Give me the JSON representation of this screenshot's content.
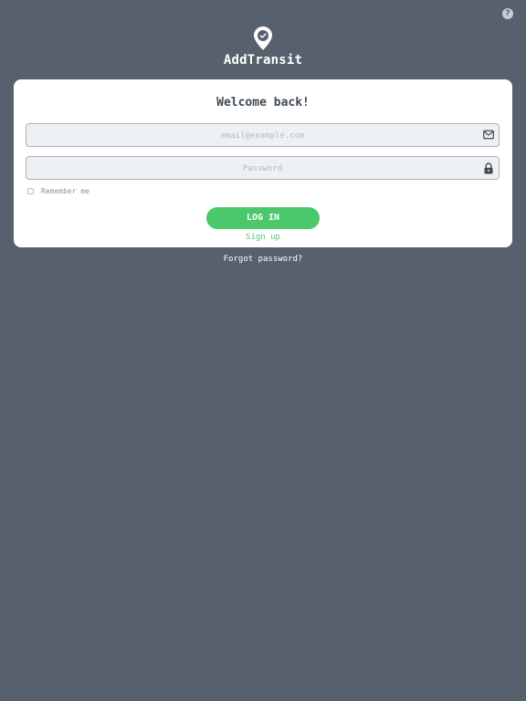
{
  "app": {
    "name": "AddTransit"
  },
  "header": {
    "help_label": "?"
  },
  "login_card": {
    "heading": "Welcome back!",
    "email_placeholder": "email@example.com",
    "email_value": "",
    "password_placeholder": "Password",
    "password_value": "",
    "remember_label": "Remember me",
    "remember_checked": false,
    "login_label": "LOG IN",
    "signup_label": "Sign up"
  },
  "footer": {
    "forgot_label": "Forgot password?"
  },
  "icons": {
    "brand": "map-pin-check-icon",
    "help": "help-icon",
    "email": "envelope-icon",
    "password": "lock-icon"
  },
  "colors": {
    "background": "#56616d",
    "accent": "#4bc96a",
    "card": "#ffffff",
    "field": "#eef1f4"
  }
}
